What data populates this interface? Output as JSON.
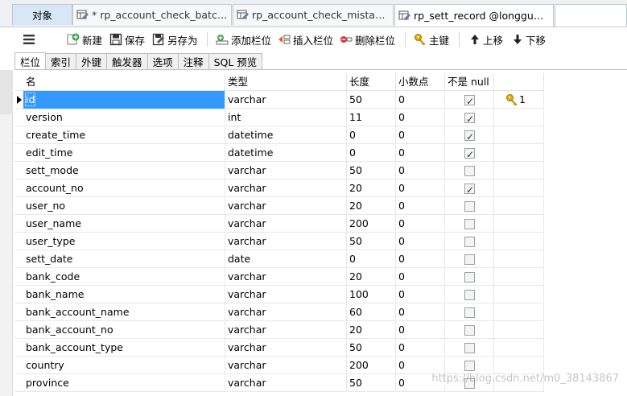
{
  "window_tabs": [
    {
      "label": "对象"
    },
    {
      "label": "* rp_account_check_batch @..."
    },
    {
      "label": "rp_account_check_mistake_s..."
    },
    {
      "label": "rp_sett_record @longguo-p..."
    }
  ],
  "toolbar": {
    "new_label": "新建",
    "save_label": "保存",
    "save_as_label": "另存为",
    "add_field_label": "添加栏位",
    "insert_field_label": "插入栏位",
    "delete_field_label": "删除栏位",
    "primary_key_label": "主键",
    "move_up_label": "上移",
    "move_down_label": "下移"
  },
  "sub_tabs": [
    "栏位",
    "索引",
    "外键",
    "触发器",
    "选项",
    "注释",
    "SQL 预览"
  ],
  "grid": {
    "columns": [
      "名",
      "类型",
      "长度",
      "小数点",
      "不是 null",
      ""
    ],
    "rows": [
      {
        "name": "id",
        "type": "varchar",
        "length": "50",
        "decimals": "0",
        "not_null": true,
        "key": "1"
      },
      {
        "name": "version",
        "type": "int",
        "length": "11",
        "decimals": "0",
        "not_null": true,
        "key": ""
      },
      {
        "name": "create_time",
        "type": "datetime",
        "length": "0",
        "decimals": "0",
        "not_null": true,
        "key": ""
      },
      {
        "name": "edit_time",
        "type": "datetime",
        "length": "0",
        "decimals": "0",
        "not_null": true,
        "key": ""
      },
      {
        "name": "sett_mode",
        "type": "varchar",
        "length": "50",
        "decimals": "0",
        "not_null": false,
        "key": ""
      },
      {
        "name": "account_no",
        "type": "varchar",
        "length": "20",
        "decimals": "0",
        "not_null": true,
        "key": ""
      },
      {
        "name": "user_no",
        "type": "varchar",
        "length": "20",
        "decimals": "0",
        "not_null": false,
        "key": ""
      },
      {
        "name": "user_name",
        "type": "varchar",
        "length": "200",
        "decimals": "0",
        "not_null": false,
        "key": ""
      },
      {
        "name": "user_type",
        "type": "varchar",
        "length": "50",
        "decimals": "0",
        "not_null": false,
        "key": ""
      },
      {
        "name": "sett_date",
        "type": "date",
        "length": "0",
        "decimals": "0",
        "not_null": false,
        "key": ""
      },
      {
        "name": "bank_code",
        "type": "varchar",
        "length": "20",
        "decimals": "0",
        "not_null": false,
        "key": ""
      },
      {
        "name": "bank_name",
        "type": "varchar",
        "length": "100",
        "decimals": "0",
        "not_null": false,
        "key": ""
      },
      {
        "name": "bank_account_name",
        "type": "varchar",
        "length": "60",
        "decimals": "0",
        "not_null": false,
        "key": ""
      },
      {
        "name": "bank_account_no",
        "type": "varchar",
        "length": "20",
        "decimals": "0",
        "not_null": false,
        "key": ""
      },
      {
        "name": "bank_account_type",
        "type": "varchar",
        "length": "50",
        "decimals": "0",
        "not_null": false,
        "key": ""
      },
      {
        "name": "country",
        "type": "varchar",
        "length": "200",
        "decimals": "0",
        "not_null": false,
        "key": ""
      },
      {
        "name": "province",
        "type": "varchar",
        "length": "50",
        "decimals": "0",
        "not_null": false,
        "key": ""
      }
    ]
  },
  "watermark": "https://blog.csdn.net/m0_38143867",
  "colors": {
    "selection": "#3399ff",
    "active_tab": "#d7e7f8",
    "key_icon": "#e0a800"
  }
}
